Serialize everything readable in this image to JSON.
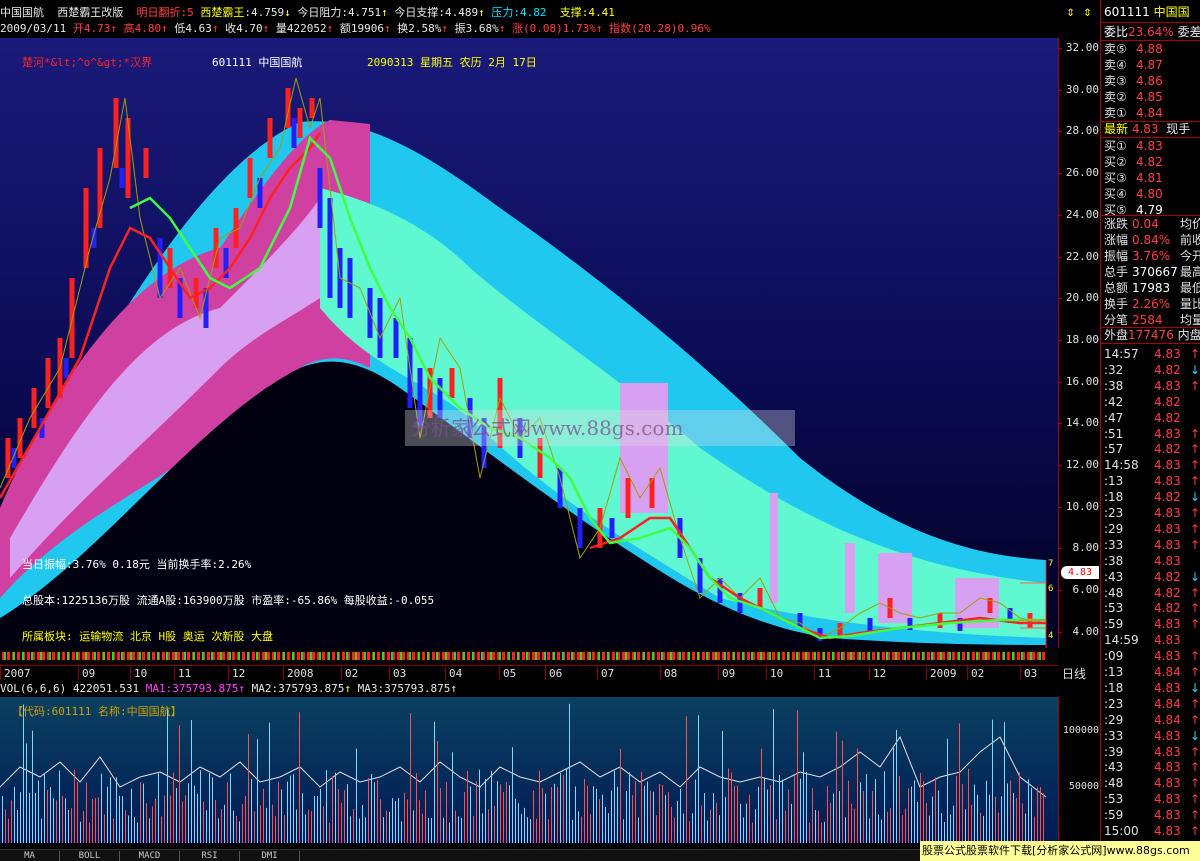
{
  "header": {
    "stock_name": "中国国航",
    "formula": "西楚霸王改版",
    "tomorrow_label": "明日翻折",
    "tomorrow_value": "5",
    "king_label": "西楚霸王",
    "king_value": "4.759",
    "res_label": "今日阻力",
    "res_value": "4.751",
    "sup_label": "今日支撑",
    "sup_value": "4.489",
    "pressure_label": "压力",
    "pressure_value": "4.82",
    "support_label": "支撑",
    "support_value": "4.41"
  },
  "header2": {
    "date": "2009/03/11",
    "open": "开4.73",
    "high": "高4.80",
    "low": "低4.63",
    "close": "收4.70",
    "volume": "量422052",
    "amount": "额19906",
    "turnover": "换2.58%",
    "amplitude": "振3.68%",
    "change": "涨(0.08)1.73%",
    "index": "指数(20.28)0.96%"
  },
  "overlay": {
    "river": "楚河*&lt;^o^&gt;*汉界",
    "code_name": "601111  中国国航",
    "date_info": "2090313  星期五  农历 2月  17日",
    "watermark": "分析家公式网www.88gs.com",
    "amplitude_line": "当日振幅:3.76%    0.18元     当前换手率:2.26%",
    "capital_line": "总股本:1225136万股  流通A股:163900万股  市盈率:-65.86%   每股收益:-0.055",
    "sector_line": "所属板块:  运输物流  北京  H股  奥运  次新股  大盘",
    "price_tag": "4.83"
  },
  "right_axis": {
    "labels": [
      "32.00",
      "30.00",
      "28.00",
      "26.00",
      "24.00",
      "22.00",
      "20.00",
      "18.00",
      "16.00",
      "14.00",
      "12.00",
      "10.00",
      "8.00",
      "6.00",
      "4.00"
    ]
  },
  "xaxis": {
    "labels": [
      "2007",
      "09",
      "10",
      "11",
      "12",
      "2008",
      "02",
      "03",
      "04",
      "05",
      "06",
      "07",
      "08",
      "09",
      "10",
      "11",
      "12",
      "2009",
      "02",
      "03"
    ],
    "right_label": "日线"
  },
  "volume": {
    "header_prefix": "VOL(6,6,6) 422051.531",
    "ma1": "MA1:375793.875",
    "ma2": "MA2:375793.875",
    "ma3": "MA3:375793.875",
    "code_label": "【代码:601111  名称:中国国航】",
    "axis_labels": [
      "100000",
      "50000"
    ]
  },
  "tabs": [
    "MA",
    "BOLL",
    "MACD",
    "RSI",
    "DMI"
  ],
  "banner": "股票公式股票软件下载[分析家公式网]www.88gs.com",
  "sidebar": {
    "code": "601111",
    "name": "中国国",
    "ratio_label": "委比",
    "ratio_value": "23.64%",
    "ratio_tail": "委差",
    "asks": [
      {
        "label": "卖⑤",
        "price": "4.88"
      },
      {
        "label": "卖④",
        "price": "4.87"
      },
      {
        "label": "卖③",
        "price": "4.86"
      },
      {
        "label": "卖②",
        "price": "4.85"
      },
      {
        "label": "卖①",
        "price": "4.84"
      }
    ],
    "latest_label": "最新",
    "latest_value": "4.83",
    "latest_tail": "现手",
    "bids": [
      {
        "label": "买①",
        "price": "4.83"
      },
      {
        "label": "买②",
        "price": "4.82"
      },
      {
        "label": "买③",
        "price": "4.81"
      },
      {
        "label": "买④",
        "price": "4.80"
      },
      {
        "label": "买⑤",
        "price": "4.79"
      }
    ],
    "stats": [
      {
        "label": "涨跌",
        "value": "0.04",
        "tail": "均价"
      },
      {
        "label": "涨幅",
        "value": "0.84%",
        "tail": "前收"
      },
      {
        "label": "振幅",
        "value": "3.76%",
        "tail": "今开"
      },
      {
        "label": "总手",
        "value": "370667",
        "tail": "最高"
      },
      {
        "label": "总额",
        "value": "17983",
        "tail": "最低"
      },
      {
        "label": "换手",
        "value": "2.26%",
        "tail": "量比"
      },
      {
        "label": "分笔",
        "value": "2584",
        "tail": "均量"
      }
    ],
    "outer_label": "外盘",
    "outer_value": "177476",
    "inner_label": "内盘",
    "ticks": [
      {
        "t": "14:57",
        "p": "4.83",
        "a": "↑"
      },
      {
        "t": ":32",
        "p": "4.82",
        "a": "↓"
      },
      {
        "t": ":38",
        "p": "4.83",
        "a": "↑"
      },
      {
        "t": ":42",
        "p": "4.82",
        "a": ""
      },
      {
        "t": ":47",
        "p": "4.82",
        "a": ""
      },
      {
        "t": ":51",
        "p": "4.83",
        "a": "↑"
      },
      {
        "t": ":57",
        "p": "4.82",
        "a": "↑"
      },
      {
        "t": "14:58",
        "p": "4.83",
        "a": "↑"
      },
      {
        "t": ":13",
        "p": "4.83",
        "a": "↑"
      },
      {
        "t": ":18",
        "p": "4.82",
        "a": "↓"
      },
      {
        "t": ":23",
        "p": "4.83",
        "a": "↑"
      },
      {
        "t": ":29",
        "p": "4.83",
        "a": "↑"
      },
      {
        "t": ":33",
        "p": "4.83",
        "a": "↑"
      },
      {
        "t": ":38",
        "p": "4.83",
        "a": ""
      },
      {
        "t": ":43",
        "p": "4.82",
        "a": "↓"
      },
      {
        "t": ":48",
        "p": "4.82",
        "a": "↑"
      },
      {
        "t": ":53",
        "p": "4.82",
        "a": "↑"
      },
      {
        "t": ":59",
        "p": "4.83",
        "a": "↑"
      },
      {
        "t": "14:59",
        "p": "4.83",
        "a": ""
      },
      {
        "t": ":09",
        "p": "4.83",
        "a": "↑"
      },
      {
        "t": ":13",
        "p": "4.84",
        "a": "↑"
      },
      {
        "t": ":18",
        "p": "4.83",
        "a": "↓"
      },
      {
        "t": ":23",
        "p": "4.84",
        "a": "↑"
      },
      {
        "t": ":29",
        "p": "4.84",
        "a": "↑"
      },
      {
        "t": ":33",
        "p": "4.83",
        "a": "↓"
      },
      {
        "t": ":39",
        "p": "4.83",
        "a": "↑"
      },
      {
        "t": ":43",
        "p": "4.83",
        "a": "↑"
      },
      {
        "t": ":48",
        "p": "4.83",
        "a": "↑"
      },
      {
        "t": ":53",
        "p": "4.83",
        "a": "↑"
      },
      {
        "t": ":59",
        "p": "4.83",
        "a": "↑"
      },
      {
        "t": "15:00",
        "p": "4.83",
        "a": "↑"
      }
    ]
  },
  "colors": {
    "up": "#ff2020",
    "down": "#2020ff",
    "band_magenta": "#d040a0",
    "band_cyan": "#20c8f0",
    "band_mint": "#60f8d0",
    "band_lilac": "#d8a0f0"
  }
}
